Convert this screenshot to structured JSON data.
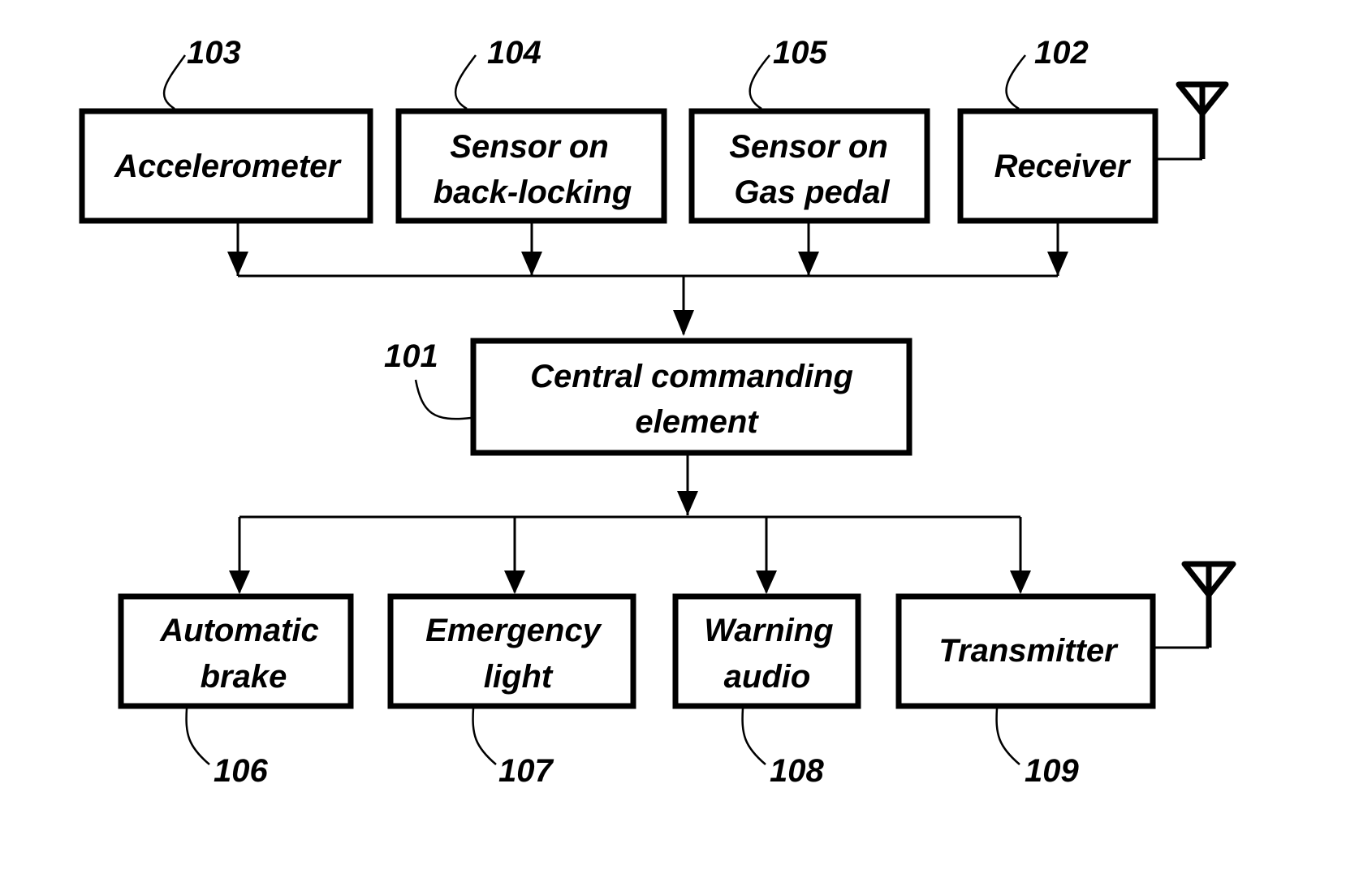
{
  "diagram": {
    "type": "block-diagram",
    "inputs": [
      {
        "id": "accelerometer",
        "ref": "103",
        "lines": [
          "Accelerometer"
        ]
      },
      {
        "id": "sensor-back-locking",
        "ref": "104",
        "lines": [
          "Sensor on",
          "back-locking"
        ]
      },
      {
        "id": "sensor-gas-pedal",
        "ref": "105",
        "lines": [
          "Sensor on",
          "Gas pedal"
        ]
      },
      {
        "id": "receiver",
        "ref": "102",
        "lines": [
          "Receiver"
        ],
        "antenna": true
      }
    ],
    "central": {
      "id": "central-commanding-element",
      "ref": "101",
      "lines": [
        "Central commanding",
        "element"
      ]
    },
    "outputs": [
      {
        "id": "automatic-brake",
        "ref": "106",
        "lines": [
          "Automatic",
          "brake"
        ]
      },
      {
        "id": "emergency-light",
        "ref": "107",
        "lines": [
          "Emergency",
          "light"
        ]
      },
      {
        "id": "warning-audio",
        "ref": "108",
        "lines": [
          "Warning",
          "audio"
        ]
      },
      {
        "id": "transmitter",
        "ref": "109",
        "lines": [
          "Transmitter"
        ],
        "antenna": true
      }
    ],
    "edges": [
      {
        "from": "accelerometer",
        "to": "central-commanding-element"
      },
      {
        "from": "sensor-back-locking",
        "to": "central-commanding-element"
      },
      {
        "from": "sensor-gas-pedal",
        "to": "central-commanding-element"
      },
      {
        "from": "receiver",
        "to": "central-commanding-element"
      },
      {
        "from": "central-commanding-element",
        "to": "automatic-brake"
      },
      {
        "from": "central-commanding-element",
        "to": "emergency-light"
      },
      {
        "from": "central-commanding-element",
        "to": "warning-audio"
      },
      {
        "from": "central-commanding-element",
        "to": "transmitter"
      }
    ]
  }
}
